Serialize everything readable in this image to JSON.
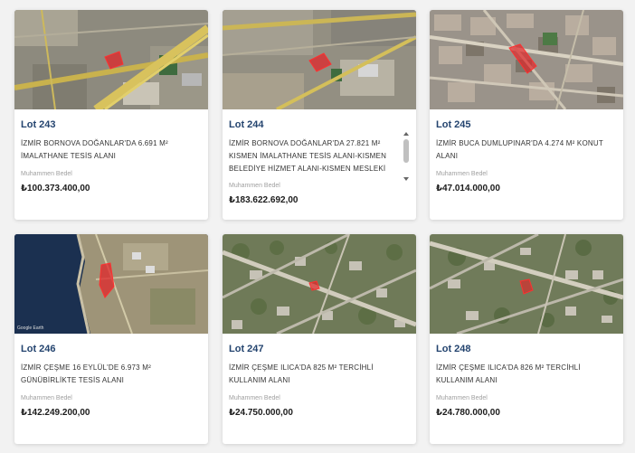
{
  "price_label": "Muhammen Bedel",
  "lots": [
    {
      "lot": "Lot 243",
      "desc": "İZMİR BORNOVA DOĞANLAR'DA 6.691 M² İMALATHANE TESİS ALANI",
      "price": "₺100.373.400,00",
      "map": "industrial-aerial"
    },
    {
      "lot": "Lot 244",
      "desc": "İZMİR BORNOVA DOĞANLAR'DA 27.821 M² KISMEN İMALATHANE TESİS ALANI-KISMEN BELEDİYE HİZMET ALANI-KISMEN MESLEKİ",
      "price": "₺183.622.692,00",
      "map": "industrial-aerial"
    },
    {
      "lot": "Lot 245",
      "desc": "İZMİR BUCA DUMLUPINAR'DA 4.274 M² KONUT ALANI",
      "price": "₺47.014.000,00",
      "map": "urban-aerial"
    },
    {
      "lot": "Lot 246",
      "desc": "İZMİR ÇEŞME 16 EYLÜL'DE 6.973 M² GÜNÜBİRLİKTE TESİS ALANI",
      "price": "₺142.249.200,00",
      "map": "coastal-aerial",
      "credit": "Google Earth"
    },
    {
      "lot": "Lot 247",
      "desc": "İZMİR ÇEŞME ILICA'DA 825 M² TERCİHLİ KULLANIM ALANI",
      "price": "₺24.750.000,00",
      "map": "suburban-aerial"
    },
    {
      "lot": "Lot 248",
      "desc": "İZMİR ÇEŞME ILICA'DA 826 M² TERCİHLİ KULLANIM ALANI",
      "price": "₺24.780.000,00",
      "map": "suburban-aerial"
    }
  ]
}
